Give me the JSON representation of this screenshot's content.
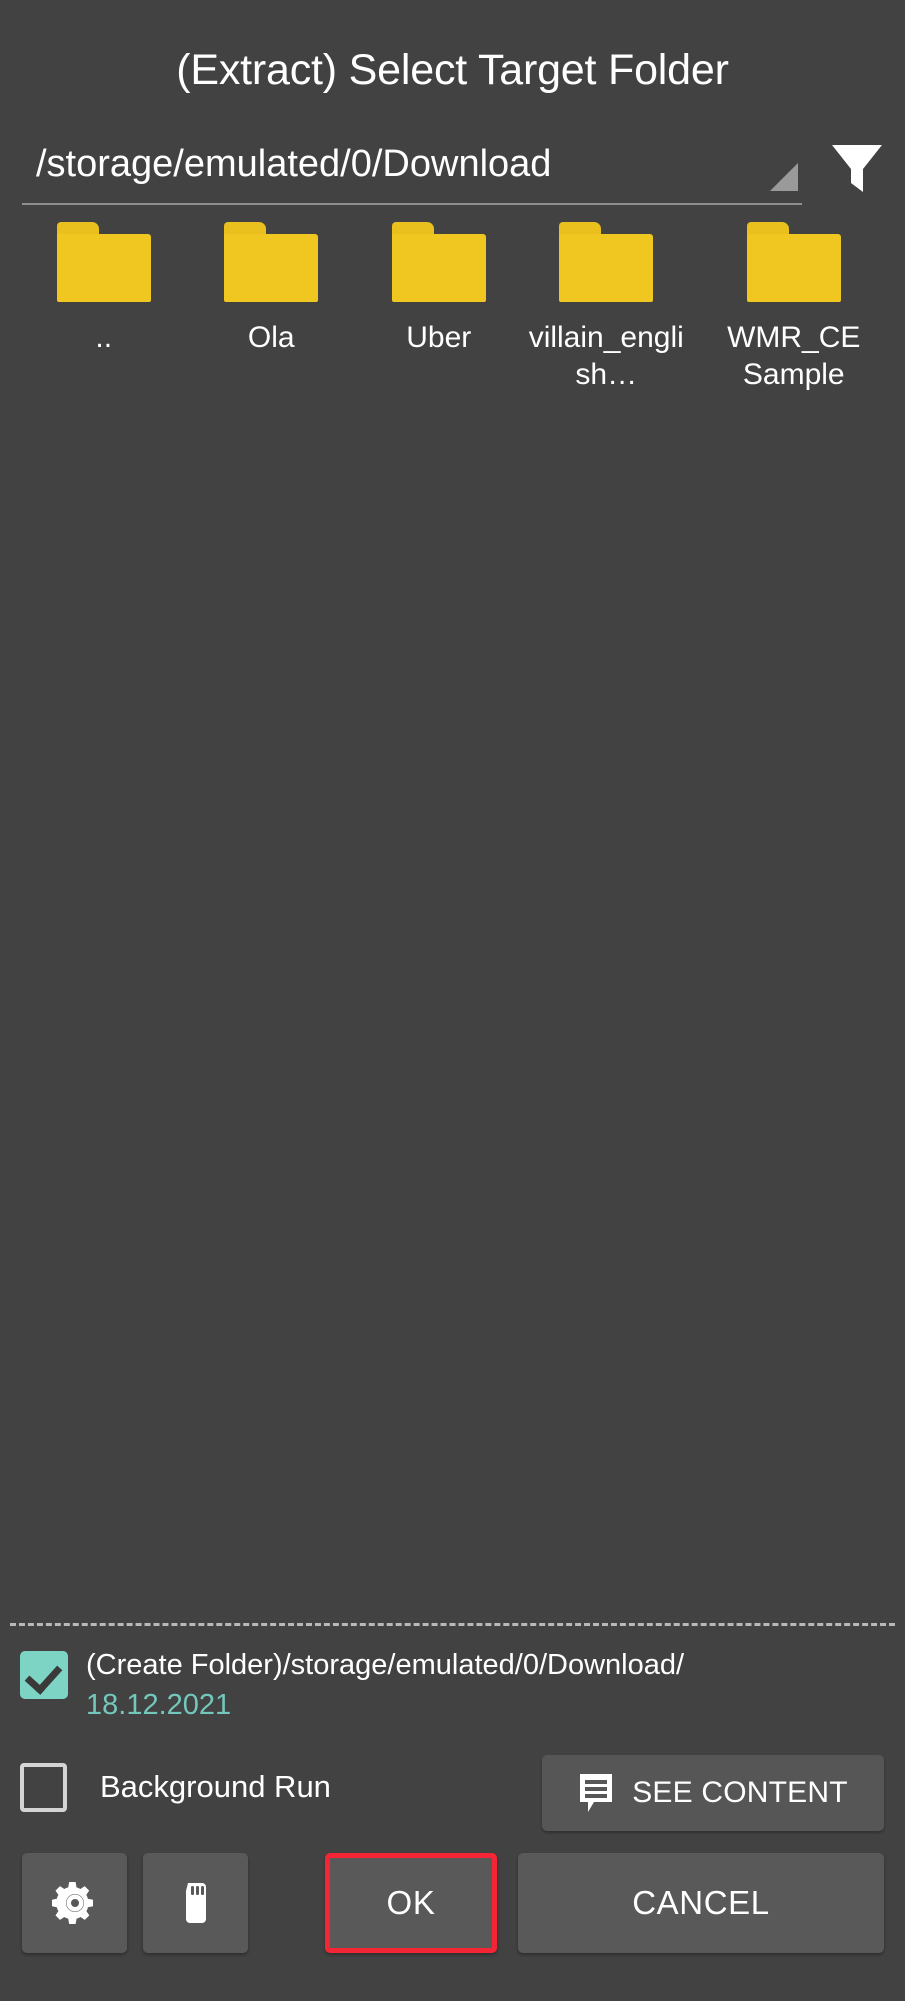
{
  "window": {
    "title": "(Extract) Select Target Folder",
    "background_color": "#424242"
  },
  "path_bar": {
    "value": "/storage/emulated/0/Download",
    "spinner_icon": "dropdown-caret-icon",
    "filter_icon": "filter-funnel-icon"
  },
  "file_grid": {
    "items": [
      {
        "label": "..",
        "icon": "folder-icon"
      },
      {
        "label": "Ola",
        "icon": "folder-icon"
      },
      {
        "label": "Uber",
        "icon": "folder-icon"
      },
      {
        "label": "villain_english…",
        "icon": "folder-icon"
      },
      {
        "label": "WMR_CE Sample",
        "icon": "folder-icon"
      }
    ],
    "folder_color": "#f0c721"
  },
  "options": {
    "create_folder": {
      "checked": true,
      "line1": "(Create Folder)/storage/emulated/0/Download/",
      "line2": "18.12.2021",
      "accent_color": "#7ed4c4",
      "date_color": "#74c7bb"
    },
    "background_run": {
      "checked": false,
      "label": "Background Run"
    },
    "see_content": {
      "label": "SEE CONTENT",
      "icon": "comment-lines-icon"
    }
  },
  "actions": {
    "settings": {
      "icon": "gear-icon",
      "label": ""
    },
    "sdcard": {
      "icon": "sd-card-icon",
      "label": ""
    },
    "ok": {
      "label": "OK",
      "highlight_color": "#f42534"
    },
    "cancel": {
      "label": "CANCEL"
    }
  }
}
